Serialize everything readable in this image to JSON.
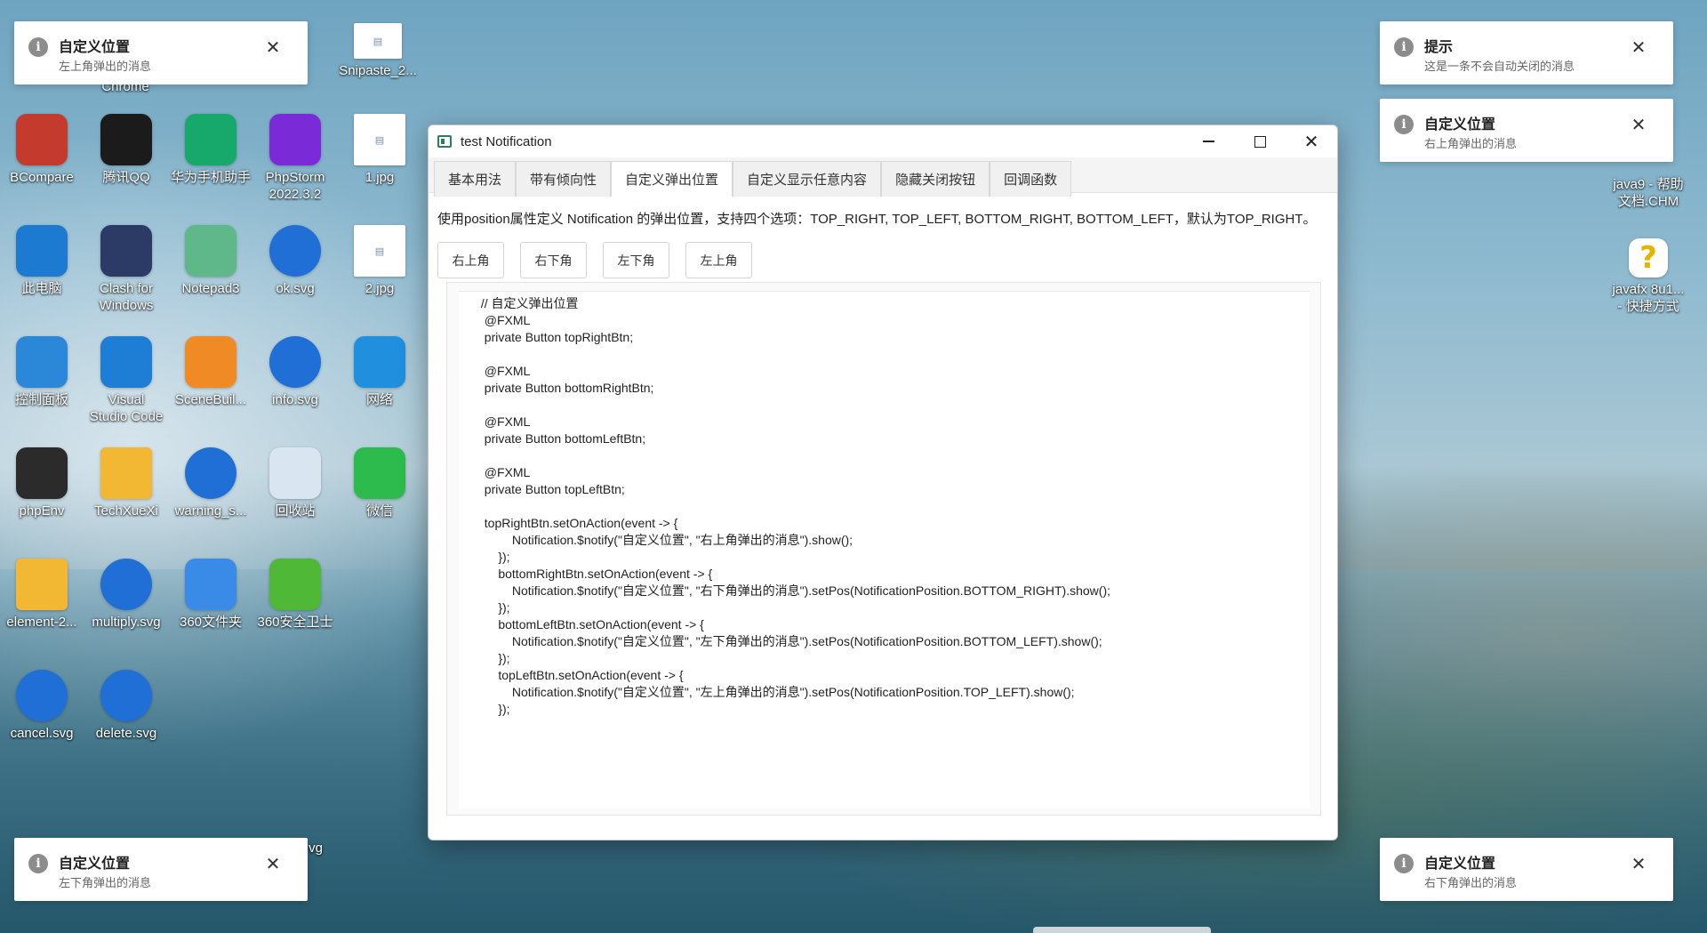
{
  "desktop": {
    "icons": [
      {
        "label": "BCompare",
        "icon": "bcompare-icon",
        "color": "#c43b2e"
      },
      {
        "label": "腾讯QQ",
        "icon": "qq-icon",
        "color": "#1b1b1b"
      },
      {
        "label": "华为手机助手",
        "icon": "huawei-assistant-icon",
        "color": "#17a86b"
      },
      {
        "label": "PhpStorm\n2022.3.2",
        "icon": "phpstorm-icon",
        "color": "#7b2ad7"
      },
      {
        "label": "1.jpg",
        "icon": "image-file-icon",
        "color": "#ffffff"
      },
      {
        "label": "此电脑",
        "icon": "computer-icon",
        "color": "#1c7bd1"
      },
      {
        "label": "Clash for\nWindows",
        "icon": "clash-icon",
        "color": "#2c3a66"
      },
      {
        "label": "Notepad3",
        "icon": "notepad3-icon",
        "color": "#5fb88a"
      },
      {
        "label": "ok.svg",
        "icon": "edge-icon",
        "color": "#1f6fd6"
      },
      {
        "label": "2.jpg",
        "icon": "image-file-icon",
        "color": "#ffffff"
      },
      {
        "label": "控制面板",
        "icon": "control-panel-icon",
        "color": "#2b87d8"
      },
      {
        "label": "Visual\nStudio Code",
        "icon": "vscode-icon",
        "color": "#1e7ed6"
      },
      {
        "label": "SceneBuil...",
        "icon": "scenebuilder-icon",
        "color": "#f08a24"
      },
      {
        "label": "info.svg",
        "icon": "edge-icon",
        "color": "#1f6fd6"
      },
      {
        "label": "网络",
        "icon": "network-icon",
        "color": "#1f8fde"
      },
      {
        "label": "phpEnv",
        "icon": "phpenv-icon",
        "color": "#2b2b2b"
      },
      {
        "label": "TechXueXi",
        "icon": "folder-icon",
        "color": "#f2b733"
      },
      {
        "label": "warning_s...",
        "icon": "edge-icon",
        "color": "#1f6fd6"
      },
      {
        "label": "回收站",
        "icon": "recycle-bin-icon",
        "color": "#d9e6f2"
      },
      {
        "label": "微信",
        "icon": "wechat-icon",
        "color": "#2dbb4e"
      },
      {
        "label": "element-2...",
        "icon": "folder-icon",
        "color": "#f2b733"
      },
      {
        "label": "multiply.svg",
        "icon": "edge-icon",
        "color": "#1f6fd6"
      },
      {
        "label": "360文件夹",
        "icon": "360-folder-icon",
        "color": "#3a8be8"
      },
      {
        "label": "360安全卫士",
        "icon": "360-security-icon",
        "color": "#4fb837"
      },
      {
        "label": "cancel.svg",
        "icon": "edge-icon",
        "color": "#1f6fd6"
      },
      {
        "label": "delete.svg",
        "icon": "edge-icon",
        "color": "#1f6fd6"
      }
    ],
    "partial_labels": {
      "chrome": "Chrome",
      "snipaste": "Snipaste_2...",
      "java9": "java9 - 帮助\n文档.CHM",
      "javafx": "javafx 8u1...\n- 快捷方式",
      "bottom_right_partial": "vg"
    }
  },
  "notifications": {
    "top_left": {
      "title": "自定义位置",
      "message": "左上角弹出的消息"
    },
    "top_right_1": {
      "title": "提示",
      "message": "这是一条不会自动关闭的消息"
    },
    "top_right_2": {
      "title": "自定义位置",
      "message": "右上角弹出的消息"
    },
    "bottom_left": {
      "title": "自定义位置",
      "message": "左下角弹出的消息"
    },
    "bottom_right": {
      "title": "自定义位置",
      "message": "右下角弹出的消息"
    },
    "info_glyph": "i",
    "close_glyph": "✕"
  },
  "window": {
    "title": "test Notification",
    "controls": {
      "close": "✕"
    },
    "tabs": [
      {
        "label": "基本用法"
      },
      {
        "label": "带有倾向性"
      },
      {
        "label": "自定义弹出位置"
      },
      {
        "label": "自定义显示任意内容"
      },
      {
        "label": "隐藏关闭按钮"
      },
      {
        "label": "回调函数"
      }
    ],
    "active_tab": "自定义弹出位置",
    "description": "使用position属性定义 Notification 的弹出位置，支持四个选项：TOP_RIGHT, TOP_LEFT, BOTTOM_RIGHT, BOTTOM_LEFT，默认为TOP_RIGHT。",
    "buttons": {
      "top_right": "右上角",
      "bottom_right": "右下角",
      "bottom_left": "左下角",
      "top_left": "左上角"
    },
    "code": " // 自定义弹出位置\n  @FXML\n  private Button topRightBtn;\n\n  @FXML\n  private Button bottomRightBtn;\n\n  @FXML\n  private Button bottomLeftBtn;\n\n  @FXML\n  private Button topLeftBtn;\n\n  topRightBtn.setOnAction(event -> {\n          Notification.$notify(\"自定义位置\", \"右上角弹出的消息\").show();\n      });\n      bottomRightBtn.setOnAction(event -> {\n          Notification.$notify(\"自定义位置\", \"右下角弹出的消息\").setPos(NotificationPosition.BOTTOM_RIGHT).show();\n      });\n      bottomLeftBtn.setOnAction(event -> {\n          Notification.$notify(\"自定义位置\", \"左下角弹出的消息\").setPos(NotificationPosition.BOTTOM_LEFT).show();\n      });\n      topLeftBtn.setOnAction(event -> {\n          Notification.$notify(\"自定义位置\", \"左上角弹出的消息\").setPos(NotificationPosition.TOP_LEFT).show();\n      });"
  }
}
